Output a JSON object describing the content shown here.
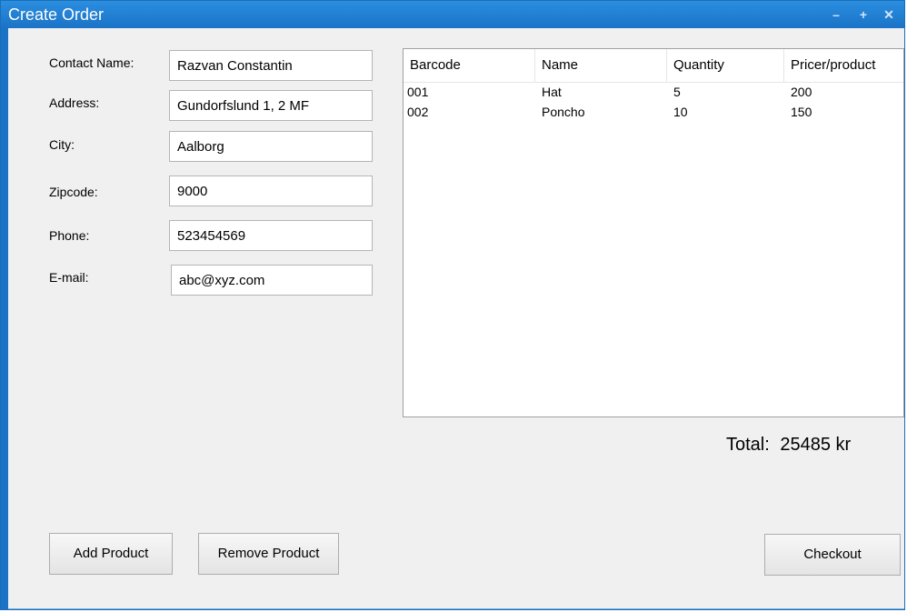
{
  "window": {
    "title": "Create Order"
  },
  "titlebar": {
    "minimize_glyph": "–",
    "maximize_glyph": "+",
    "close_glyph": "✕"
  },
  "form": {
    "contact_name": {
      "label": "Contact Name:",
      "value": "Razvan Constantin"
    },
    "address": {
      "label": "Address:",
      "value": "Gundorfslund 1, 2 MF"
    },
    "city": {
      "label": "City:",
      "value": "Aalborg"
    },
    "zipcode": {
      "label": "Zipcode:",
      "value": "9000"
    },
    "phone": {
      "label": "Phone:",
      "value": "523454569"
    },
    "email": {
      "label": "E-mail:",
      "value": "abc@xyz.com"
    }
  },
  "table": {
    "columns": [
      "Barcode",
      "Name",
      "Quantity",
      "Pricer/product"
    ],
    "rows": [
      [
        "001",
        "Hat",
        "5",
        "200"
      ],
      [
        "002",
        "Poncho",
        "10",
        "150"
      ]
    ]
  },
  "total": {
    "label": "Total:",
    "value": "25485 kr"
  },
  "buttons": {
    "add_product": "Add Product",
    "remove_product": "Remove Product",
    "checkout": "Checkout"
  },
  "colors": {
    "titlebar": "#1a73c6",
    "background": "#f0f0f0"
  },
  "icons": [
    "minimize-icon",
    "maximize-icon",
    "close-icon"
  ]
}
